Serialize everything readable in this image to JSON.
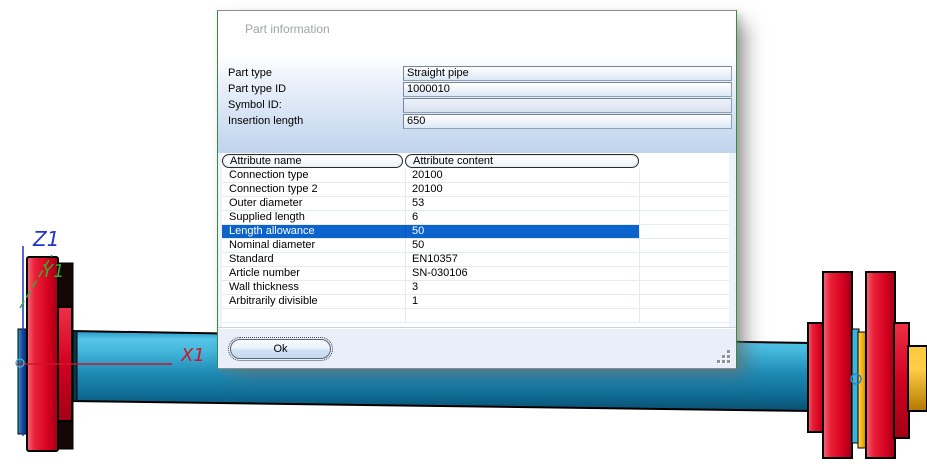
{
  "scene": {
    "axis_labels": {
      "z": "Z1",
      "y": "Y1",
      "x": "X1"
    },
    "colors": {
      "axis_x": "#cc1525",
      "axis_y": "#2fae35",
      "axis_z": "#2233cc",
      "pipe_teal": "#1f8cb6",
      "flange_red": "#d40020",
      "gasket_yellow": "#e8a200",
      "sliver_cyan": "#3ab4da",
      "marker_blue": "#2e86c8"
    }
  },
  "dialog": {
    "title": "Part information",
    "fields": [
      {
        "label": "Part type",
        "value": "Straight pipe"
      },
      {
        "label": "Part type ID",
        "value": "1000010"
      },
      {
        "label": "Symbol ID:",
        "value": ""
      },
      {
        "label": "Insertion length",
        "value": "650"
      }
    ],
    "table": {
      "columns": [
        "Attribute name",
        "Attribute content"
      ],
      "selected_row": "Length allowance",
      "selection_color": "#0b63cb",
      "rows": [
        {
          "name": "Connection type",
          "content": "20100"
        },
        {
          "name": "Connection type 2",
          "content": "20100"
        },
        {
          "name": "Outer diameter",
          "content": "53"
        },
        {
          "name": "Supplied length",
          "content": "6"
        },
        {
          "name": "Length allowance",
          "content": "50"
        },
        {
          "name": "Nominal diameter",
          "content": "50"
        },
        {
          "name": "Standard",
          "content": "EN10357"
        },
        {
          "name": "Article number",
          "content": "SN-030106"
        },
        {
          "name": "Wall thickness",
          "content": "3"
        },
        {
          "name": "Arbitrarily divisible",
          "content": "1"
        }
      ]
    },
    "ok_label": "Ok"
  }
}
